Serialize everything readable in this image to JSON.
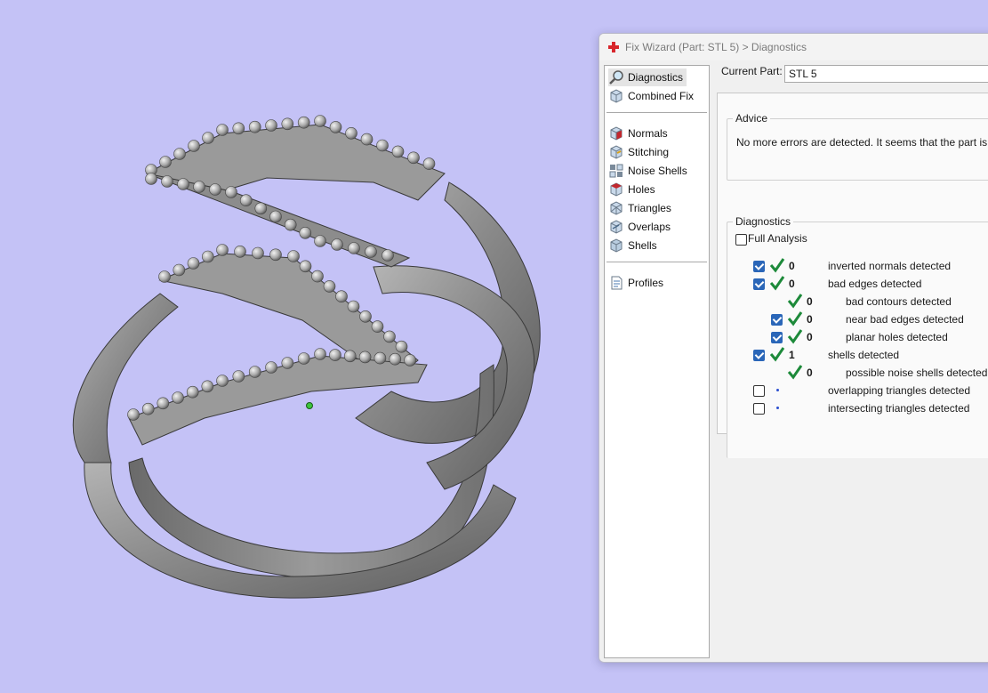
{
  "window": {
    "title": "Fix Wizard (Part: STL 5) > Diagnostics"
  },
  "nav": {
    "items": [
      {
        "label": "Diagnostics",
        "icon": "magnifier-icon",
        "selected": true
      },
      {
        "label": "Combined Fix",
        "icon": "cube-icon"
      },
      {
        "label": "Normals",
        "icon": "normals-cube-icon"
      },
      {
        "label": "Stitching",
        "icon": "stitching-cube-icon"
      },
      {
        "label": "Noise Shells",
        "icon": "noise-shells-icon"
      },
      {
        "label": "Holes",
        "icon": "holes-cube-icon"
      },
      {
        "label": "Triangles",
        "icon": "triangles-cube-icon"
      },
      {
        "label": "Overlaps",
        "icon": "overlaps-cube-icon"
      },
      {
        "label": "Shells",
        "icon": "shells-cube-icon"
      },
      {
        "label": "Profiles",
        "icon": "document-icon"
      }
    ]
  },
  "current_part": {
    "label": "Current Part:",
    "value": "STL 5"
  },
  "advice": {
    "legend": "Advice",
    "text": "No more errors are detected. It seems that the part is ok. I"
  },
  "diagnostics": {
    "legend": "Diagnostics",
    "full_analysis_label": "Full Analysis",
    "full_analysis_checked": false,
    "rows": [
      {
        "checkbox": true,
        "checked": true,
        "status": "ok",
        "count": "0",
        "label": "inverted normals detected",
        "indent": 0
      },
      {
        "checkbox": true,
        "checked": true,
        "status": "ok",
        "count": "0",
        "label": "bad edges detected",
        "indent": 0
      },
      {
        "checkbox": false,
        "checked": false,
        "status": "ok",
        "count": "0",
        "label": "bad contours detected",
        "indent": 1
      },
      {
        "checkbox": true,
        "checked": true,
        "status": "ok",
        "count": "0",
        "label": "near bad edges detected",
        "indent": 1
      },
      {
        "checkbox": true,
        "checked": true,
        "status": "ok",
        "count": "0",
        "label": "planar holes detected",
        "indent": 1
      },
      {
        "checkbox": true,
        "checked": true,
        "status": "ok",
        "count": "1",
        "label": "shells detected",
        "indent": 0
      },
      {
        "checkbox": false,
        "checked": false,
        "status": "ok",
        "count": "0",
        "label": "possible noise shells detected",
        "indent": 1
      },
      {
        "checkbox": true,
        "checked": false,
        "status": "pending",
        "count": "",
        "label": "overlapping triangles detected",
        "indent": 0
      },
      {
        "checkbox": true,
        "checked": false,
        "status": "pending",
        "count": "",
        "label": "intersecting triangles detected",
        "indent": 0
      }
    ]
  },
  "colors": {
    "background": "#c4c2f6",
    "model": "#8e8e8e",
    "check_accent": "#2a66b8",
    "ok_tick": "#1d8a3a",
    "pending_dot": "#2a4ecf",
    "cursor_marker": "#3cc43c"
  }
}
